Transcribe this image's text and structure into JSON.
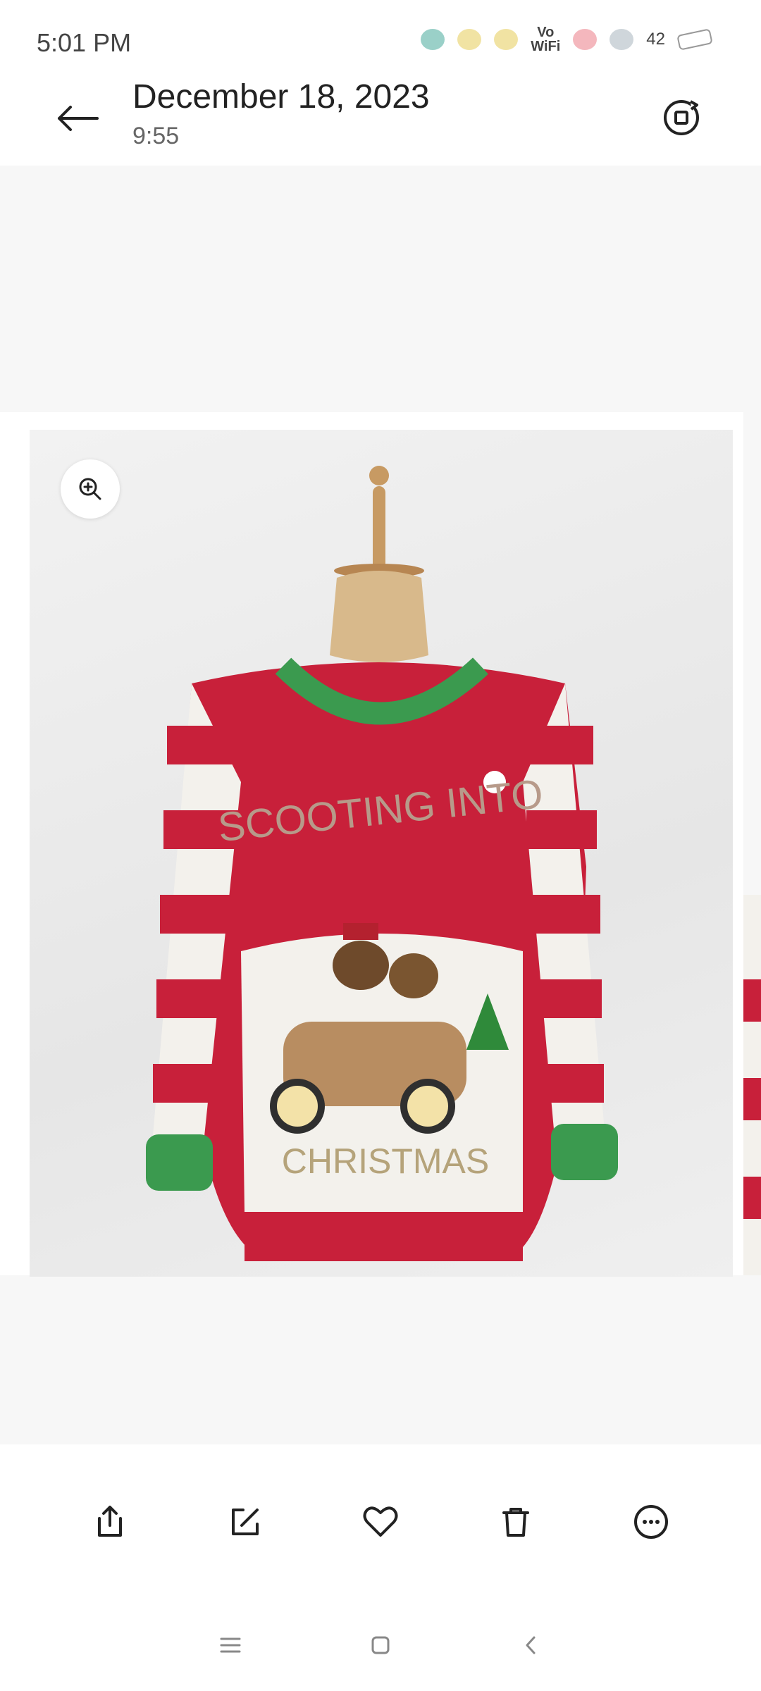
{
  "status_bar": {
    "time": "5:01 PM",
    "vowifi_top": "Vo",
    "vowifi_bottom": "WiFi",
    "battery": "42"
  },
  "header": {
    "date": "December 18, 2023",
    "time": "9:55",
    "back_icon": "arrow-left-icon",
    "rotate_icon": "rotate-icon"
  },
  "photo": {
    "text_top": "SCOOTING INTO",
    "text_bottom": "CHRISTMAS"
  },
  "toolbar": {
    "items": [
      {
        "icon": "share-icon"
      },
      {
        "icon": "edit-icon"
      },
      {
        "icon": "heart-icon"
      },
      {
        "icon": "trash-icon"
      },
      {
        "icon": "more-icon"
      }
    ]
  },
  "navigation": {
    "items": [
      {
        "icon": "menu-icon"
      },
      {
        "icon": "home-icon"
      },
      {
        "icon": "back-icon"
      }
    ]
  },
  "colors": {
    "sweater_red": "#c8203a",
    "sweater_white": "#f3f1ec",
    "trim_green": "#3b9a4f",
    "icon_dark": "#222222"
  }
}
